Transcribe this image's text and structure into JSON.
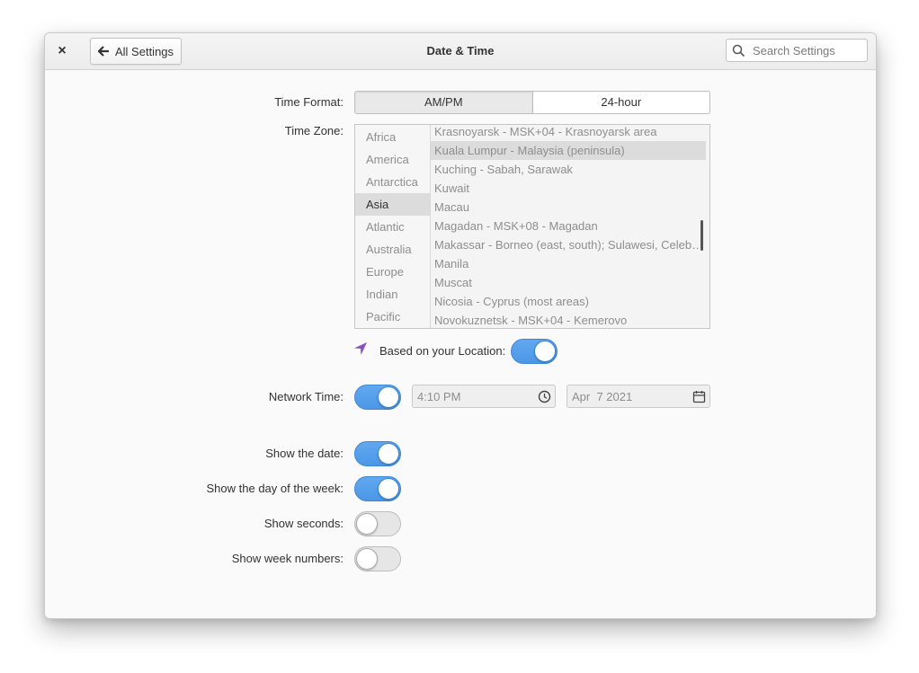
{
  "window": {
    "title": "Date & Time"
  },
  "titlebar": {
    "close_glyph": "×",
    "back_label": "All Settings",
    "search_placeholder": "Search Settings"
  },
  "time_format": {
    "label": "Time Format:",
    "options": [
      "AM/PM",
      "24-hour"
    ],
    "selected": "AM/PM"
  },
  "time_zone": {
    "label": "Time Zone:",
    "regions": [
      "Africa",
      "America",
      "Antarctica",
      "Asia",
      "Atlantic",
      "Australia",
      "Europe",
      "Indian",
      "Pacific"
    ],
    "selected_region": "Asia",
    "cities": [
      "Krasnoyarsk - MSK+04 - Krasnoyarsk area",
      "Kuala Lumpur - Malaysia (peninsula)",
      "Kuching - Sabah, Sarawak",
      "Kuwait",
      "Macau",
      "Magadan - MSK+08 - Magadan",
      "Makassar - Borneo (east, south); Sulawesi, Celebes...",
      "Manila",
      "Muscat",
      "Nicosia - Cyprus (most areas)",
      "Novokuznetsk - MSK+04 - Kemerovo"
    ],
    "selected_city": "Kuala Lumpur - Malaysia (peninsula)"
  },
  "location": {
    "label": "Based on your Location:",
    "enabled": true,
    "icon": "location-arrow-icon",
    "icon_color": "#8a4fc8"
  },
  "network_time": {
    "label": "Network Time:",
    "enabled": true,
    "time_value": "4:10 PM",
    "date_value": "Apr  7 2021"
  },
  "toggles": [
    {
      "label": "Show the date:",
      "enabled": true
    },
    {
      "label": "Show the day of the week:",
      "enabled": true
    },
    {
      "label": "Show seconds:",
      "enabled": false
    },
    {
      "label": "Show week numbers:",
      "enabled": false
    }
  ],
  "colors": {
    "accent": "#4c97e6",
    "background": "#fafafa"
  }
}
